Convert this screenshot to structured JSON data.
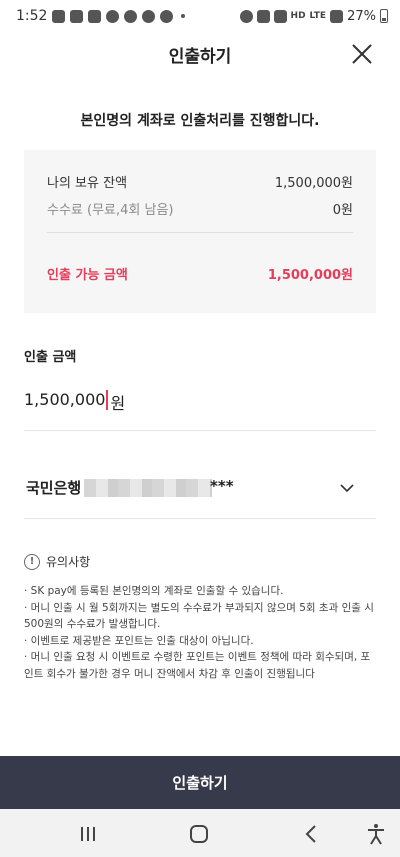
{
  "status_bar": {
    "time": "1:52",
    "network_small": "HD",
    "network_lte": "LTE",
    "battery": "27%"
  },
  "header": {
    "title": "인출하기",
    "close_icon": "close-icon"
  },
  "intro": "본인명의 계좌로 인출처리를 진행합니다.",
  "balance": {
    "held_label": "나의 보유 잔액",
    "held_value": "1,500,000원",
    "fee_label": "수수료 (무료,4회 남음)",
    "fee_value": "0원",
    "available_label": "인출 가능 금액",
    "available_value": "1,500,000원"
  },
  "amount": {
    "label": "인출 금액",
    "value": "1,500,000",
    "unit": "원"
  },
  "bank": {
    "name": "국민은행",
    "masked_suffix": "***"
  },
  "notice": {
    "title": "유의사항",
    "items": [
      "· SK pay에 등록된 본인명의의 계좌로 인출할 수 있습니다.",
      "· 머니 인출 시 월 5회까지는 별도의 수수료가 부과되지 않으며 5회 초과 인출 시 500원의 수수료가 발생합니다.",
      "· 이벤트로 제공받은 포인트는 인출 대상이 아닙니다.",
      "· 머니 인출 요청 시 이벤트로 수령한 포인트는 이벤트 정책에 따라 회수되며, 포인트 회수가 불가한 경우 머니 잔액에서 차감 후 인출이 진행됩니다"
    ]
  },
  "submit_label": "인출하기",
  "colors": {
    "accent": "#e53d5b",
    "button_bg": "#373a4a",
    "box_bg": "#f6f6f6"
  }
}
